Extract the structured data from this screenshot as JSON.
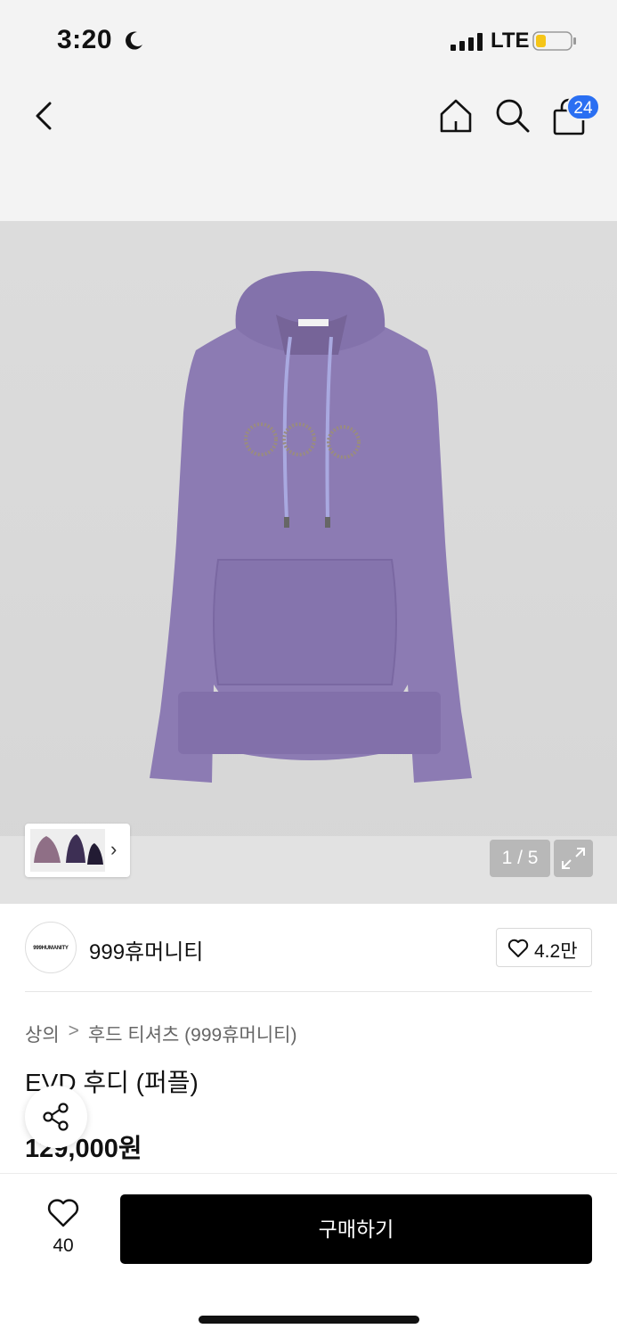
{
  "status_bar": {
    "time": "3:20",
    "network": "LTE",
    "icons": [
      "moon-icon",
      "signal-icon",
      "battery-icon"
    ]
  },
  "header": {
    "icons": [
      "back-icon",
      "home-icon",
      "search-icon",
      "cart-icon"
    ],
    "cart_badge": "24",
    "badge_color": "#2a6ff2"
  },
  "gallery": {
    "page_indicator": "1 / 5",
    "thumb_icon": "chevron-right-icon",
    "expand_icon": "expand-icon",
    "image_subject": "purple hoodie",
    "hoodie_color": "#8c7bb3"
  },
  "brand": {
    "logo_text": "999HUMANITY",
    "name": "999휴머니티",
    "like_count": "4.2만"
  },
  "product": {
    "breadcrumb": [
      "상의",
      "후드 티셔츠 (999휴머니티)"
    ],
    "breadcrumb_separator": ">",
    "title": "EVD 후디 (퍼플)",
    "price": "129,000원"
  },
  "bottom_bar": {
    "wish_count": "40",
    "buy_label": "구매하기"
  }
}
